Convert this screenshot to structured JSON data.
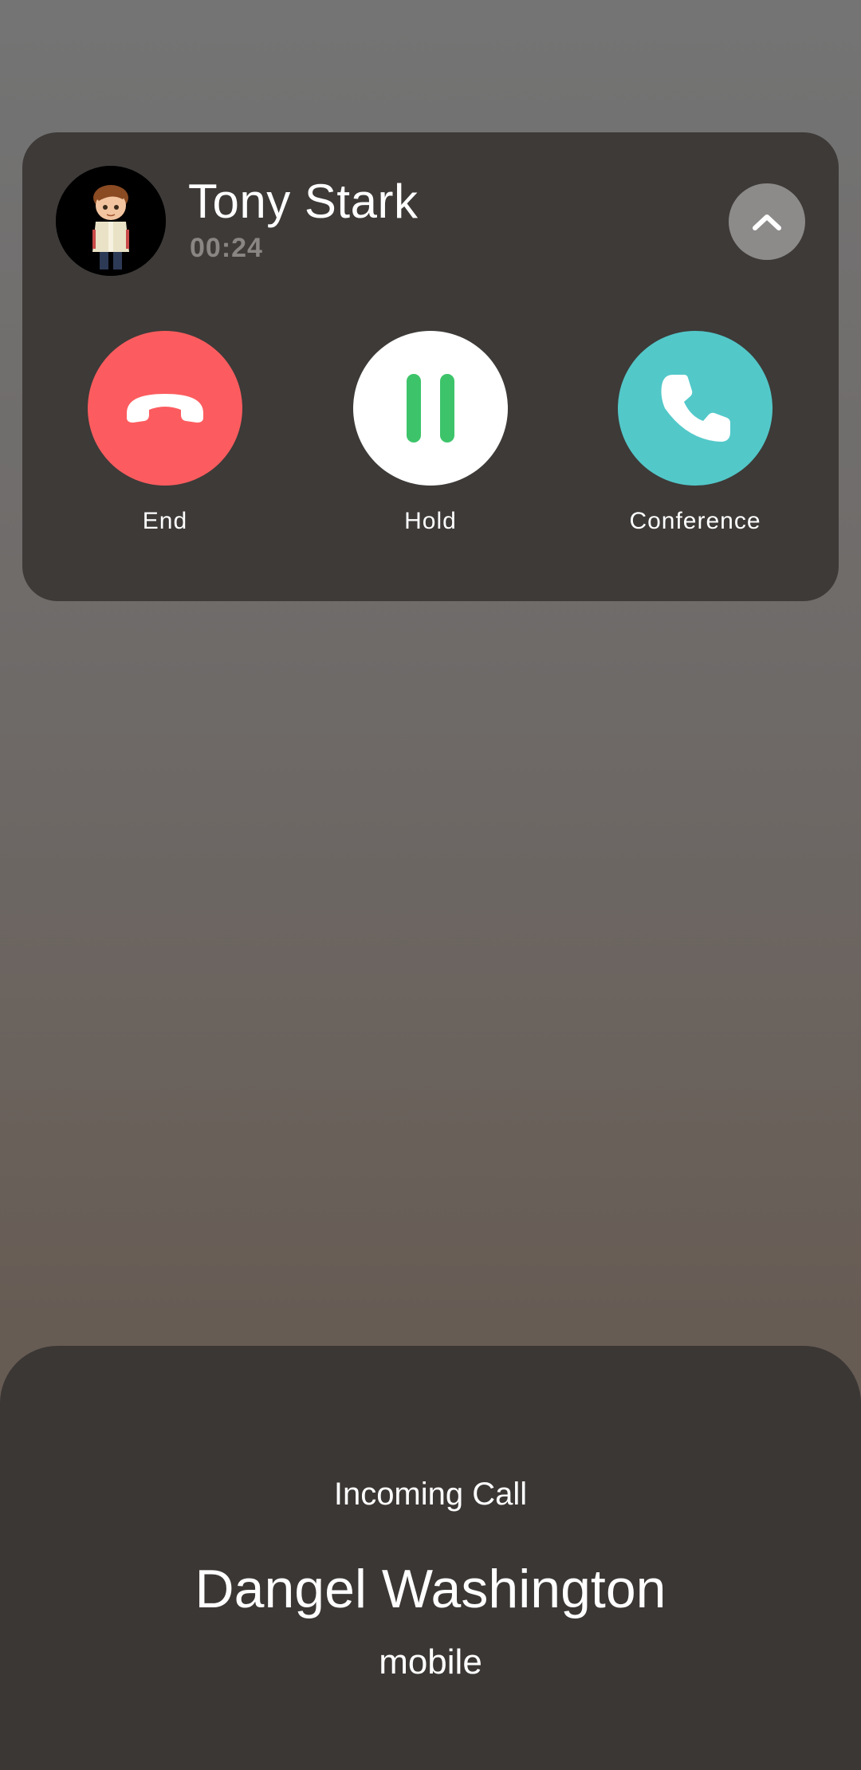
{
  "active_call": {
    "caller_name": "Tony Stark",
    "duration": "00:24",
    "avatar_icon": "cartoon-boy-avatar",
    "collapse_icon": "chevron-up-icon",
    "actions": [
      {
        "label": "End",
        "icon": "phone-hangup-icon",
        "color": "#fc5c5f"
      },
      {
        "label": "Hold",
        "icon": "pause-icon",
        "color": "#ffffff",
        "icon_color": "#3dc46a"
      },
      {
        "label": "Conference",
        "icon": "phone-icon",
        "color": "#53c8c9"
      }
    ]
  },
  "incoming_call": {
    "label": "Incoming Call",
    "caller_name": "Dangel Washington",
    "number_type": "mobile"
  },
  "colors": {
    "card_background": "#3d3a38",
    "sheet_background": "#3b3735"
  }
}
